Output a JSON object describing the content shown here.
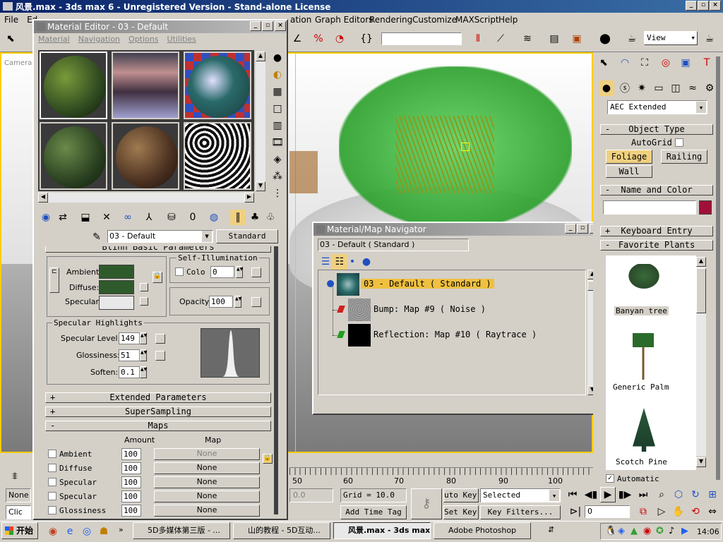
{
  "window": {
    "title": "风景.max - 3ds max 6 - Unregistered Version - Stand-alone License"
  },
  "menu": [
    "File",
    "Ed",
    "ation",
    "Graph Editors",
    "Rendering",
    "Customize",
    "MAXScript",
    "Help"
  ],
  "toolbar": {
    "view_select": "View"
  },
  "viewport": {
    "label": "Camera"
  },
  "mat_editor": {
    "title": "Material Editor - 03 - Default",
    "menu": [
      "Material",
      "Navigation",
      "Options",
      "Utilities"
    ],
    "material_name": "03 - Default",
    "material_type": "Standard",
    "basic_params_title": "Blinn Basic Parameters",
    "ambient_label": "Ambient:",
    "diffuse_label": "Diffuse:",
    "specular_label": "Specular:",
    "self_illum_title": "Self-Illumination",
    "color_label": "Colo",
    "color_value": "0",
    "opacity_label": "Opacity:",
    "opacity_value": "100",
    "spec_highlights_title": "Specular Highlights",
    "spec_level_label": "Specular Level:",
    "spec_level_value": "149",
    "gloss_label": "Glossiness:",
    "gloss_value": "51",
    "soften_label": "Soften:",
    "soften_value": "0.1",
    "extended_label": "Extended Parameters",
    "supersampling_label": "SuperSampling",
    "maps_label": "Maps",
    "amount_header": "Amount",
    "map_header": "Map",
    "maps": [
      {
        "name": "Ambient",
        "amount": "100",
        "map": "None"
      },
      {
        "name": "Diffuse",
        "amount": "100",
        "map": "None"
      },
      {
        "name": "Specular",
        "amount": "100",
        "map": "None"
      },
      {
        "name": "Specular",
        "amount": "100",
        "map": "None"
      },
      {
        "name": "Glossiness",
        "amount": "100",
        "map": "None"
      }
    ]
  },
  "navigator": {
    "title": "Material/Map Navigator",
    "field": "03 - Default ( Standard )",
    "root": "03 - Default  ( Standard )",
    "bump": "Bump: Map #9   ( Noise )",
    "reflection": "Reflection: Map #10   ( Raytrace )"
  },
  "command_panel": {
    "dropdown": "AEC Extended",
    "object_type": "Object Type",
    "autogrid": "AutoGrid",
    "foliage": "Foliage",
    "railing": "Railing",
    "wall": "Wall",
    "name_color": "Name and Color",
    "keyboard_entry": "Keyboard Entry",
    "favorite_plants": "Favorite Plants",
    "plants": [
      "Banyan tree",
      "Generic Palm",
      "Scotch Pine"
    ],
    "automatic": "Automatic"
  },
  "timeline": {
    "ticks": [
      "50",
      "60",
      "70",
      "80",
      "90",
      "100"
    ]
  },
  "status": {
    "none": "None",
    "click": "Clic",
    "coord": "0.0",
    "grid": "Grid = 10.0",
    "add_time_tag": "Add Time Tag",
    "auto_key": "uto Key",
    "set_key": "Set Key",
    "selected": "Selected",
    "key_filters": "Key Filters...",
    "frame": "0"
  },
  "taskbar": {
    "start": "开始",
    "items": [
      "5D多媒体第三版 - ...",
      "山的教程 - 5D互动...",
      "风景.max - 3ds max...",
      "Adobe Photoshop"
    ],
    "clock": "14:06"
  },
  "colors": {
    "ambient": "#2f5a2c",
    "diffuse": "#2f5a2c",
    "specular": "#e8e8e8",
    "name_color_swatch": "#a0103a",
    "highlight": "#f0c040"
  }
}
